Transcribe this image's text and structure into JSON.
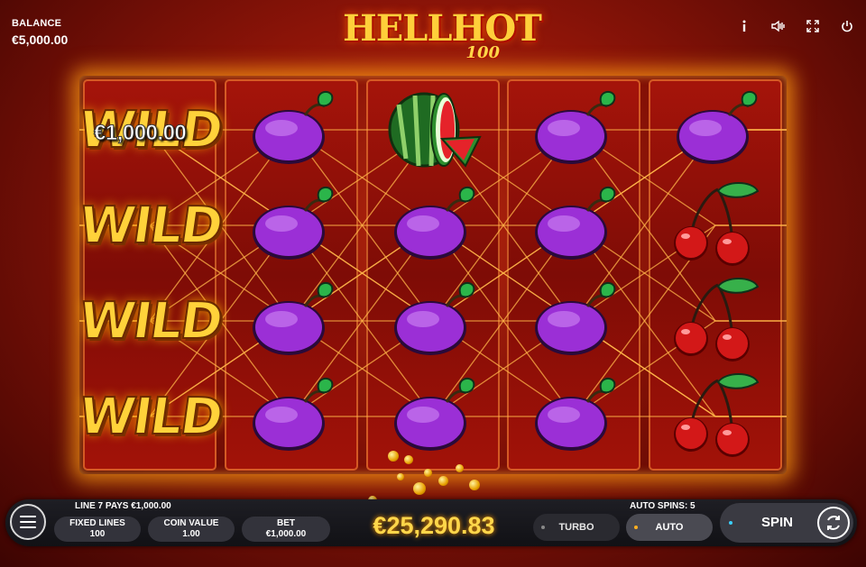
{
  "balance": {
    "label": "BALANCE",
    "value": "€5,000.00"
  },
  "logo": {
    "main": "HELLHOT",
    "sub": "100"
  },
  "top_icons": [
    "info-icon",
    "sound-icon",
    "fullscreen-icon",
    "power-icon"
  ],
  "reels": [
    [
      "wild",
      "wild",
      "wild",
      "wild"
    ],
    [
      "plum",
      "plum",
      "plum",
      "plum"
    ],
    [
      "watermelon",
      "plum",
      "plum",
      "plum"
    ],
    [
      "plum",
      "plum",
      "plum",
      "plum"
    ],
    [
      "plum",
      "cherries",
      "cherries",
      "cherries"
    ]
  ],
  "wild_label": "WILD",
  "wild_prize": "€1,000.00",
  "bottom": {
    "line_pays": "LINE 7 PAYS €1,000.00",
    "fixed_lines_label": "FIXED LINES",
    "fixed_lines_value": "100",
    "coin_value_label": "COIN VALUE",
    "coin_value_value": "1.00",
    "bet_label": "BET",
    "bet_value": "€1,000.00",
    "win_amount": "€25,290.83",
    "auto_spins": "AUTO SPINS: 5",
    "turbo_label": "TURBO",
    "auto_label": "AUTO",
    "spin_label": "SPIN"
  },
  "colors": {
    "accent_gold": "#ffd64a",
    "reel_red": "#a5140a",
    "bar_dark": "#1e1e24"
  }
}
